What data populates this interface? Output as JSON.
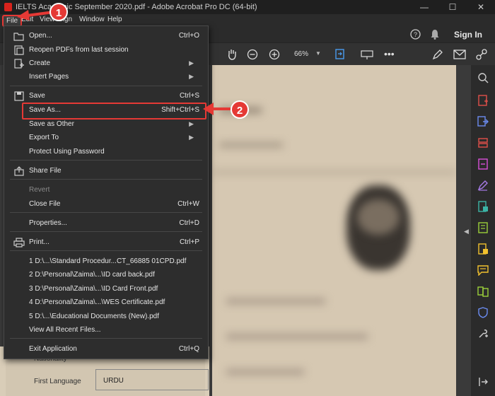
{
  "window": {
    "title": "IELTS Academic September 2020.pdf - Adobe Acrobat Pro DC (64-bit)",
    "minimize": "—",
    "maximize": "☐",
    "close": "✕"
  },
  "menubar": [
    "File",
    "Edit",
    "View",
    "Sign",
    "Window",
    "Help"
  ],
  "toolbar": {
    "sign_in": "Sign In",
    "zoom": "66%"
  },
  "file_menu": {
    "open": {
      "label": "Open...",
      "shortcut": "Ctrl+O"
    },
    "reopen": {
      "label": "Reopen PDFs from last session"
    },
    "create": {
      "label": "Create"
    },
    "insert_pages": {
      "label": "Insert Pages"
    },
    "save": {
      "label": "Save",
      "shortcut": "Ctrl+S"
    },
    "save_as": {
      "label": "Save As...",
      "shortcut": "Shift+Ctrl+S"
    },
    "save_as_other": {
      "label": "Save as Other"
    },
    "export_to": {
      "label": "Export To"
    },
    "protect": {
      "label": "Protect Using Password"
    },
    "share": {
      "label": "Share File"
    },
    "revert": {
      "label": "Revert"
    },
    "close_file": {
      "label": "Close File",
      "shortcut": "Ctrl+W"
    },
    "properties": {
      "label": "Properties...",
      "shortcut": "Ctrl+D"
    },
    "print": {
      "label": "Print...",
      "shortcut": "Ctrl+P"
    },
    "recent": [
      "1 D:\\...\\Standard Procedur...CT_66885 01CPD.pdf",
      "2 D:\\Personal\\Zaima\\...\\ID card back.pdf",
      "3 D:\\Personal\\Zaima\\...\\ID Card Front.pdf",
      "4 D:\\Personal\\Zaima\\...\\WES Certificate.pdf",
      "5 D:\\...\\Educational Documents (New).pdf"
    ],
    "view_recent": {
      "label": "View All Recent Files..."
    },
    "exit": {
      "label": "Exit Application",
      "shortcut": "Ctrl+Q"
    }
  },
  "annotations": {
    "step1": "1",
    "step2": "2"
  },
  "document": {
    "nationality": "Nationality",
    "first_language": "First Language",
    "language_value": "URDU"
  },
  "colors": {
    "accent_red": "#e53935",
    "menu_bg": "#2d2d2d"
  }
}
